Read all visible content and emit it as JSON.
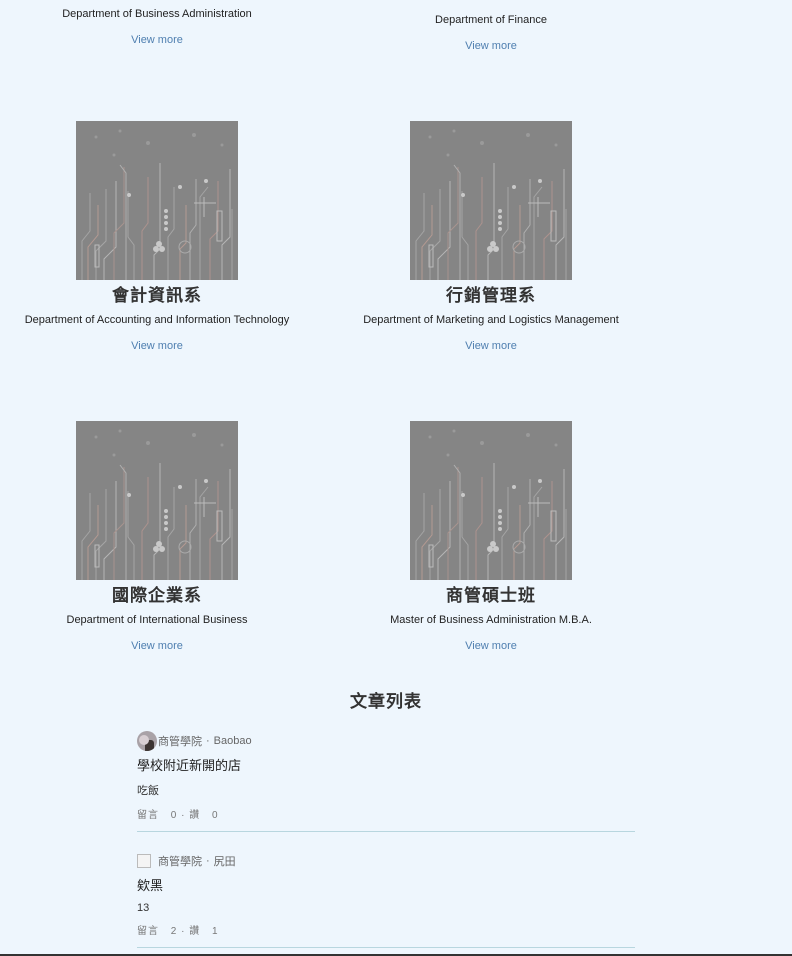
{
  "departments_top": [
    {
      "name_en": "Department of Business Administration",
      "view_more": "View more"
    },
    {
      "name_en": "Department of Finance",
      "view_more": "View more"
    }
  ],
  "departments": [
    {
      "name_zh": "會計資訊系",
      "name_en": "Department of Accounting and Information Technology",
      "view_more": "View more"
    },
    {
      "name_zh": "行銷管理系",
      "name_en": "Department of Marketing and Logistics Management",
      "view_more": "View more"
    },
    {
      "name_zh": "國際企業系",
      "name_en": "Department of International Business",
      "view_more": "View more"
    },
    {
      "name_zh": "商管碩士班",
      "name_en": "Master of Business Administration M.B.A.",
      "view_more": "View more"
    }
  ],
  "articles": {
    "title": "文章列表",
    "posts": [
      {
        "board": "商管學院",
        "sep": "·",
        "author": "Baobao",
        "title": "學校附近新開的店",
        "excerpt": "吃飯",
        "comments_label": "留言",
        "comments": "0",
        "likes_label": "讚",
        "likes": "0"
      },
      {
        "board": "商管學院",
        "sep": "·",
        "author": "尻田",
        "title": "欸黑",
        "excerpt": "13",
        "comments_label": "留言",
        "comments": "2",
        "likes_label": "讚",
        "likes": "1"
      }
    ]
  },
  "colors": {
    "background": "#eef6fd",
    "link": "#4f7fb0",
    "thumb": "#858585",
    "divider": "#b8d6df"
  },
  "icons": {
    "thumbnail": "circuit-board-image",
    "avatar": "user-avatar-icon",
    "broken_avatar": "broken-image-icon"
  }
}
